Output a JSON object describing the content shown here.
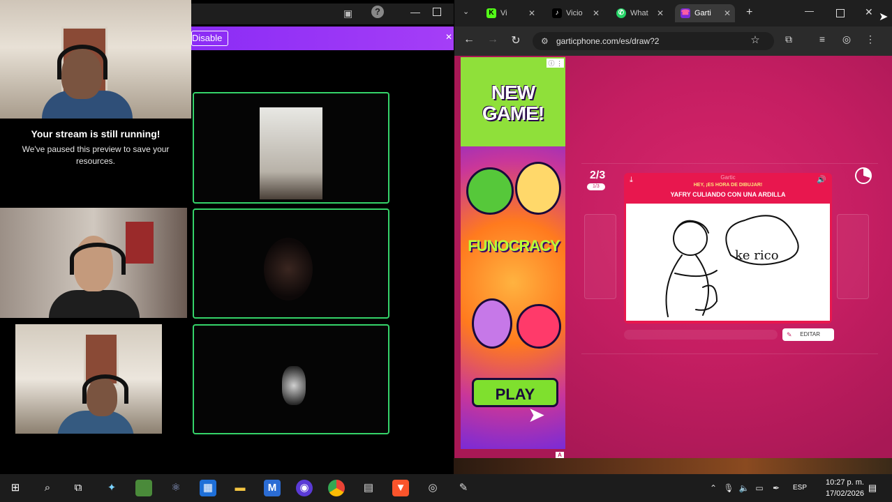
{
  "stream": {
    "paused_title": "Your stream is still running!",
    "paused_message": "We've paused this preview to save your resources.",
    "disable_label": "Disable"
  },
  "browser": {
    "tabs": [
      {
        "label": "Vi",
        "icon": "kick-icon",
        "icon_text": "K",
        "color": "#53fc18"
      },
      {
        "label": "Vicio",
        "icon": "tiktok-icon",
        "icon_text": "♪",
        "color": "#ffffff"
      },
      {
        "label": "What",
        "icon": "whatsapp-icon",
        "icon_text": "✆",
        "color": "#25d366"
      },
      {
        "label": "Garti",
        "icon": "gartic-icon",
        "icon_text": "☎",
        "color": "#ff5fa2"
      }
    ],
    "url": "garticphone.com/es/draw?2"
  },
  "ad": {
    "headline": "NEW GAME!",
    "brand": "FUNOCRACY",
    "cta": "PLAY",
    "badge": "A"
  },
  "game": {
    "round": "2/3",
    "round_sub": "1/3",
    "logo": "Gartic",
    "prompt_header": "HEY, ¡ES HORA DE DIBUJAR!",
    "prompt": "YAFRY CULIANDO CON UNA ARDILLA",
    "drawing_text": "ke rico",
    "edit_label": "EDITAR"
  },
  "taskbar": {
    "language": "ESP",
    "time": "10:27 p. m.",
    "date": "17/02/2026"
  }
}
